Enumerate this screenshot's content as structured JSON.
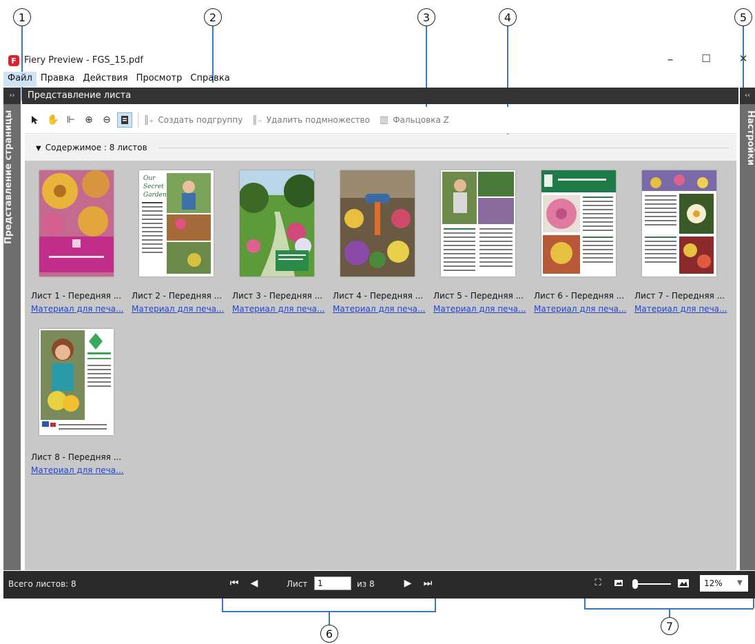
{
  "callouts": [
    "1",
    "2",
    "3",
    "4",
    "5",
    "6",
    "7"
  ],
  "window": {
    "title": "Fiery Preview - FGS_15.pdf",
    "minimize": "–",
    "maximize": "☐",
    "close": "✕"
  },
  "menu": [
    "Файл",
    "Правка",
    "Действия",
    "Просмотр",
    "Справка"
  ],
  "left_panel": {
    "toggle": "››",
    "label": "Представление страницы"
  },
  "right_panel": {
    "toggle": "‹‹",
    "label": "Настройки"
  },
  "center_panel": {
    "title": "Представление листа"
  },
  "toolbar": {
    "create_subgroup": "Создать подгруппу",
    "delete_subset": "Удалить подмножество",
    "fold_z": "Фальцовка Z"
  },
  "content": {
    "header": "Содержимое : 8 листов"
  },
  "sheets": [
    {
      "label": "Лист 1 - Передняя ...",
      "link": "Материал для печа..."
    },
    {
      "label": "Лист 2 - Передняя ...",
      "link": "Материал для печа..."
    },
    {
      "label": "Лист 3 - Передняя ...",
      "link": "Материал для печа..."
    },
    {
      "label": "Лист 4 - Передняя ...",
      "link": "Материал для печа..."
    },
    {
      "label": "Лист 5 - Передняя ...",
      "link": "Материал для печа..."
    },
    {
      "label": "Лист 6 - Передняя ...",
      "link": "Материал для печа..."
    },
    {
      "label": "Лист 7 - Передняя ...",
      "link": "Материал для печа..."
    },
    {
      "label": "Лист 8 - Передняя ...",
      "link": "Материал для печа..."
    }
  ],
  "status": {
    "total": "Всего листов: 8",
    "sheet_label": "Лист",
    "sheet_value": "1",
    "of_label": "из 8",
    "zoom": "12%"
  }
}
